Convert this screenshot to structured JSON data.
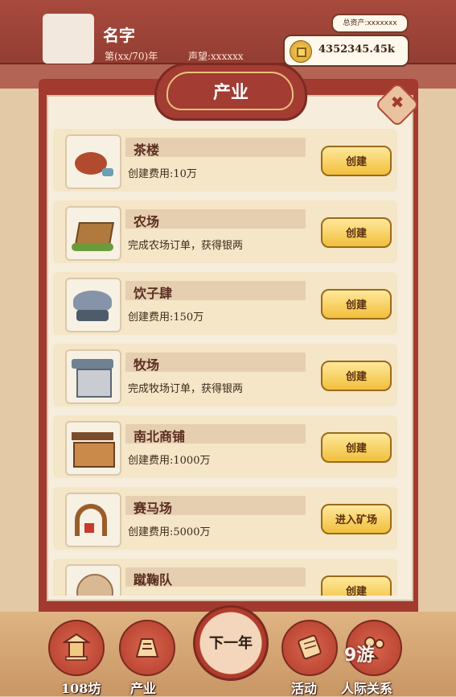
{
  "header": {
    "name": "名字",
    "year": "第(xx/70)年",
    "fame": "声望:xxxxxx",
    "total_assets": "总资产:xxxxxxx",
    "money": "4352345.45k"
  },
  "panel": {
    "title": "产业",
    "close_icon": "✖"
  },
  "industries": [
    {
      "name": "茶楼",
      "desc": "创建费用:10万",
      "action": "创建",
      "icon": "teapot-icon"
    },
    {
      "name": "农场",
      "desc": "完成农场订单，获得银两",
      "action": "创建",
      "icon": "farm-crate-icon"
    },
    {
      "name": "饮子肆",
      "desc": "创建费用:150万",
      "action": "创建",
      "icon": "drink-shop-icon"
    },
    {
      "name": "牧场",
      "desc": "完成牧场订单，获得银两",
      "action": "创建",
      "icon": "ranch-gate-icon"
    },
    {
      "name": "南北商铺",
      "desc": "创建费用:1000万",
      "action": "创建",
      "icon": "market-stall-icon"
    },
    {
      "name": "赛马场",
      "desc": "创建费用:5000万",
      "action": "进入矿场",
      "icon": "racecourse-arch-icon"
    },
    {
      "name": "蹴鞠队",
      "desc": "",
      "action": "创建",
      "icon": "cuju-ball-icon"
    }
  ],
  "bottom_nav": {
    "items": [
      {
        "label": "108坊",
        "icon": "pavilion-icon"
      },
      {
        "label": "产业",
        "icon": "industry-icon"
      },
      {
        "label": "活动",
        "icon": "scroll-icon"
      },
      {
        "label": "人际关系",
        "icon": "people-icon"
      }
    ],
    "next_year": "下一年"
  },
  "watermark": "9游"
}
